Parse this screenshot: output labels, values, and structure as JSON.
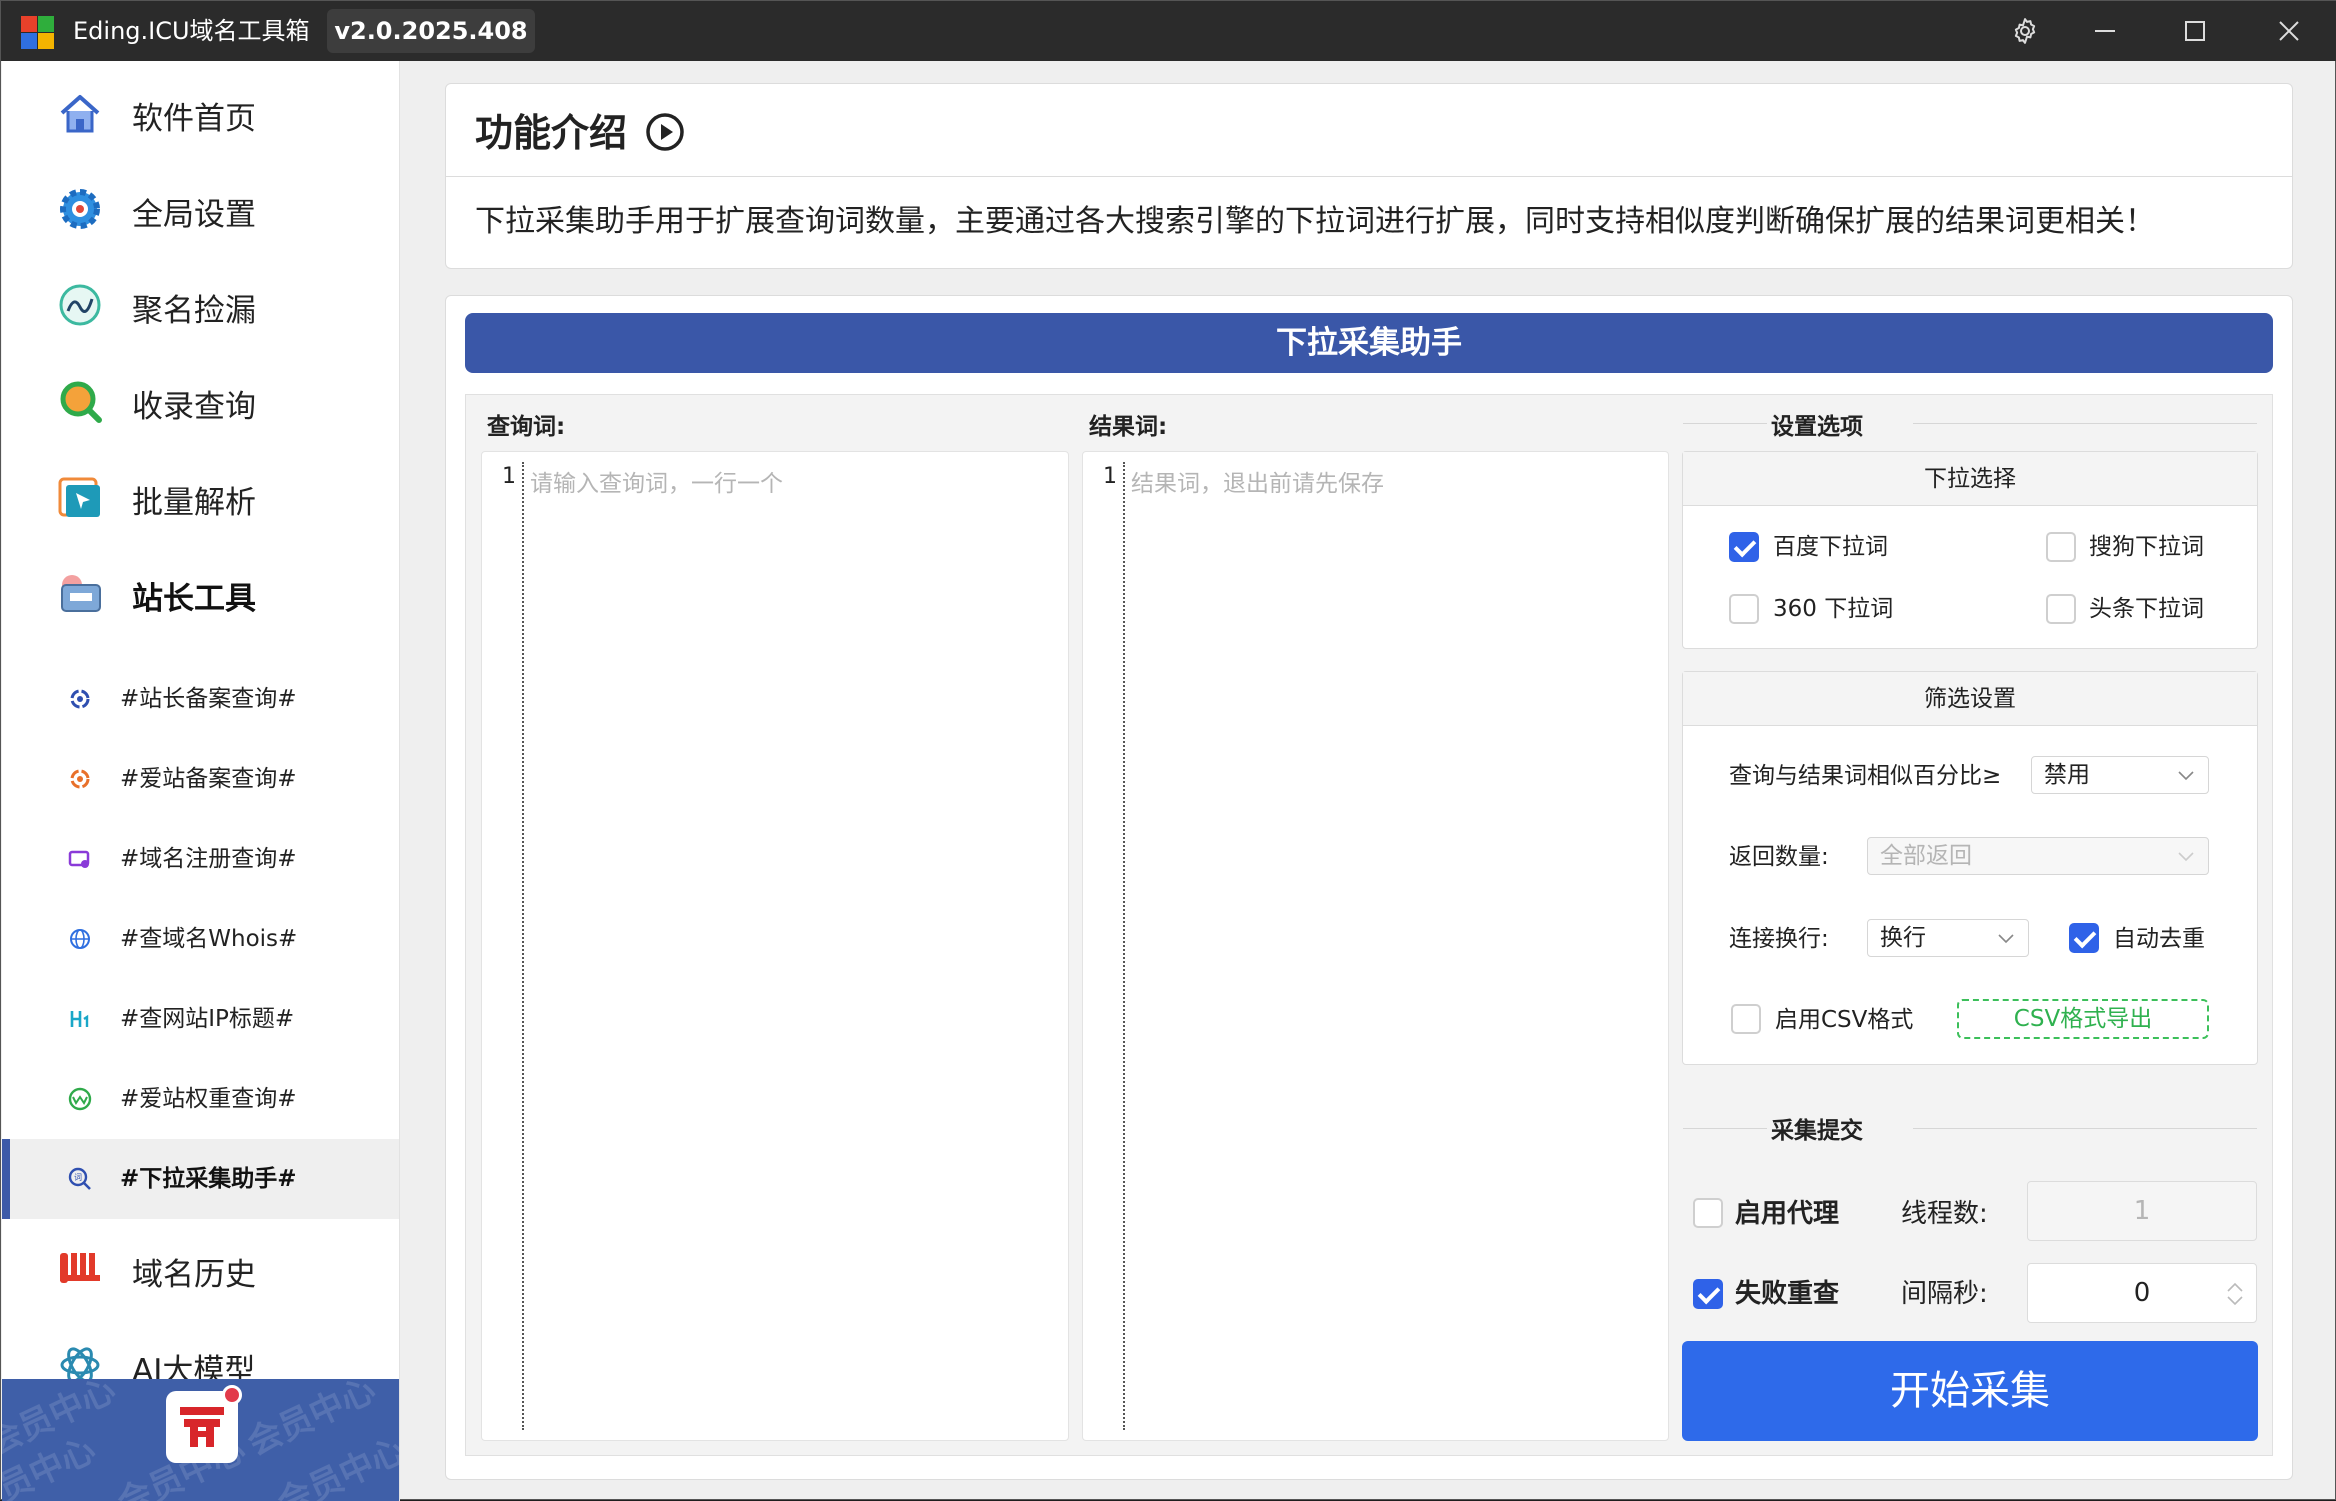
{
  "window": {
    "title": "Eding.ICU域名工具箱",
    "version": "v2.0.2025.408"
  },
  "sidebar": {
    "items": [
      {
        "label": "软件首页",
        "icon": "home-icon"
      },
      {
        "label": "全局设置",
        "icon": "gear-icon"
      },
      {
        "label": "聚名捡漏",
        "icon": "gauge-icon"
      },
      {
        "label": "收录查询",
        "icon": "magnifier-icon"
      },
      {
        "label": "批量解析",
        "icon": "cursor-icon"
      },
      {
        "label": "站长工具",
        "icon": "toolbox-icon"
      }
    ],
    "subitems": [
      {
        "label": "#站长备案查询#",
        "icon": "record-icon"
      },
      {
        "label": "#爱站备案查询#",
        "icon": "record-orange-icon"
      },
      {
        "label": "#域名注册查询#",
        "icon": "register-icon"
      },
      {
        "label": "#查域名Whois#",
        "icon": "globe-icon"
      },
      {
        "label": "#查网站IP标题#",
        "icon": "heading-icon"
      },
      {
        "label": "#爱站权重查询#",
        "icon": "weight-icon"
      },
      {
        "label": "#下拉采集助手#",
        "icon": "search-word-icon"
      }
    ],
    "bottom_items": [
      {
        "label": "域名历史",
        "icon": "history-icon"
      },
      {
        "label": "AI大模型",
        "icon": "ai-icon"
      }
    ],
    "member_watermark": "会员中心"
  },
  "intro": {
    "title": "功能介绍",
    "description": "下拉采集助手用于扩展查询词数量，主要通过各大搜索引擎的下拉词进行扩展，同时支持相似度判断确保扩展的结果词更相关！"
  },
  "tool": {
    "title": "下拉采集助手",
    "query_label": "查询词:",
    "query_line": "1",
    "query_placeholder": "请输入查询词，一行一个",
    "result_label": "结果词:",
    "result_line": "1",
    "result_placeholder": "结果词，退出前请先保存"
  },
  "settings": {
    "title": "设置选项",
    "dropdown": {
      "title": "下拉选择",
      "options": [
        {
          "label": "百度下拉词",
          "checked": true
        },
        {
          "label": "搜狗下拉词",
          "checked": false
        },
        {
          "label": "360 下拉词",
          "checked": false
        },
        {
          "label": "头条下拉词",
          "checked": false
        }
      ]
    },
    "filter": {
      "title": "筛选设置",
      "similarity_label": "查询与结果词相似百分比≥",
      "similarity_value": "禁用",
      "count_label": "返回数量:",
      "count_value": "全部返回",
      "join_label": "连接换行:",
      "join_value": "换行",
      "dedupe_label": "自动去重",
      "dedupe_checked": true,
      "csv_label": "启用CSV格式",
      "csv_checked": false,
      "csv_export": "CSV格式导出"
    },
    "submit": {
      "title": "采集提交",
      "proxy_label": "启用代理",
      "proxy_checked": false,
      "threads_label": "线程数:",
      "threads_value": "1",
      "retry_label": "失败重查",
      "retry_checked": true,
      "interval_label": "间隔秒:",
      "interval_value": "0",
      "start_label": "开始采集"
    }
  }
}
